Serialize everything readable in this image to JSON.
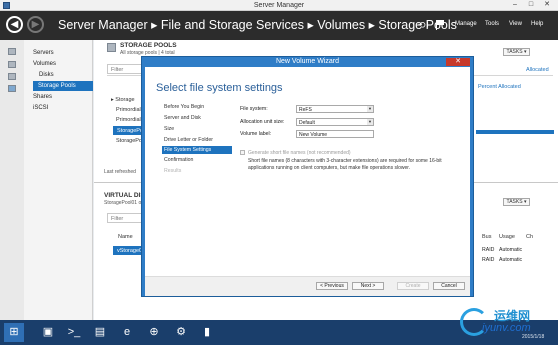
{
  "window": {
    "title": "Server Manager"
  },
  "header": {
    "breadcrumb": "Server Manager ▸ File and Storage Services ▸ Volumes ▸ Storage Pools",
    "menu": [
      "Manage",
      "Tools",
      "View",
      "Help"
    ]
  },
  "sidebar": {
    "items": [
      {
        "label": "Servers"
      },
      {
        "label": "Volumes"
      },
      {
        "label": "Disks"
      },
      {
        "label": "Storage Pools"
      },
      {
        "label": "Shares"
      },
      {
        "label": "iSCSI"
      }
    ]
  },
  "storage_pools": {
    "title": "STORAGE POOLS",
    "subtitle": "All storage pools | 4 total",
    "filter_placeholder": "Filter",
    "tasks_label": "TASKS",
    "rows": [
      "Storage",
      "Primordial",
      "Primordial",
      "StoragePool",
      "StoragePool"
    ],
    "col_percent": "Percent Allocated",
    "col_allocated": "Allocated",
    "last_refreshed": "Last refreshed"
  },
  "virtual_disks": {
    "title": "VIRTUAL DISK",
    "subtitle": "StoragePool01 on storage",
    "filter_placeholder": "Filter",
    "tasks_label": "TASKS",
    "col_name": "Name",
    "row_selected": "vStorage01",
    "columns": [
      "Bus",
      "Usage",
      "Ch"
    ],
    "rows": [
      {
        "bus": "RAID",
        "usage": "Automatic"
      },
      {
        "bus": "RAID",
        "usage": "Automatic"
      }
    ]
  },
  "dialog": {
    "title": "New Volume Wizard",
    "heading": "Select file system settings",
    "steps": [
      {
        "label": "Before You Begin"
      },
      {
        "label": "Server and Disk"
      },
      {
        "label": "Size"
      },
      {
        "label": "Drive Letter or Folder"
      },
      {
        "label": "File System Settings"
      },
      {
        "label": "Confirmation"
      },
      {
        "label": "Results"
      }
    ],
    "file_system_label": "File system:",
    "file_system_value": "ReFS",
    "alloc_label": "Allocation unit size:",
    "alloc_value": "Default",
    "volume_label_label": "Volume label:",
    "volume_label_value": "New Volume",
    "checkbox_label": "Generate short file names (not recommended)",
    "note": "Short file names (8 characters with 3-character extensions) are required for some 16-bit applications running on client computers, but make file operations slower.",
    "buttons": {
      "previous": "< Previous",
      "next": "Next >",
      "create": "Create",
      "cancel": "Cancel"
    }
  },
  "watermark": {
    "text": "运维网",
    "url": "iyunv.com"
  },
  "taskbar": {
    "date": "2015/1/18"
  },
  "colors": {
    "accent": "#1e73be",
    "header": "#2c2c2c",
    "dialog_frame": "#2f7dc7",
    "taskbar": "#1a3e6b"
  }
}
